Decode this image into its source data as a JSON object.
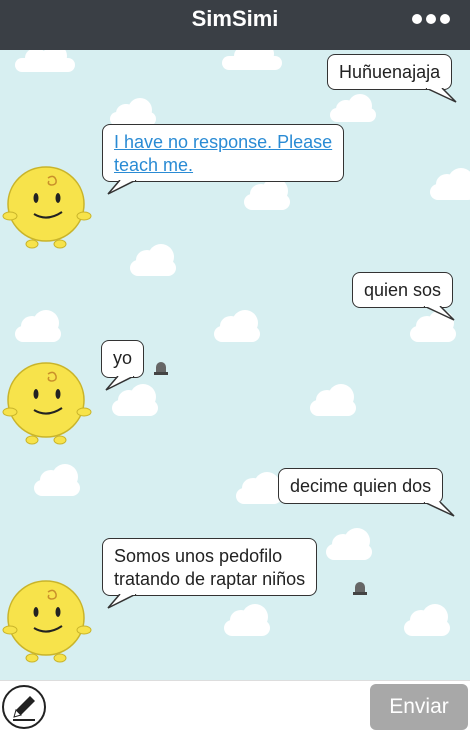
{
  "header": {
    "title": "SimSimi"
  },
  "messages": [
    {
      "from": "user",
      "text": "Huñuenajaja"
    },
    {
      "from": "sim",
      "text": "I have no response. Please teach me.",
      "line1": "I have no response. Please",
      "line2": "teach me.",
      "is_link": true
    },
    {
      "from": "user",
      "text": "quien sos"
    },
    {
      "from": "sim",
      "text": "yo"
    },
    {
      "from": "user",
      "text": "decime quien dos"
    },
    {
      "from": "sim",
      "text": "Somos unos pedofilo tratando de raptar niños",
      "line1": "Somos unos pedofilo",
      "line2": "tratando de raptar niños"
    }
  ],
  "composer": {
    "input_value": "",
    "send_label": "Enviar"
  },
  "colors": {
    "header_bg": "#3a3f45",
    "chat_bg": "#d7eff1",
    "link": "#2a8bd4",
    "send_bg": "#a8a8a8",
    "character": "#f7e34b"
  },
  "icons": {
    "header_menu": "more-dots-icon",
    "report": "siren-icon",
    "compose": "pencil-icon"
  }
}
